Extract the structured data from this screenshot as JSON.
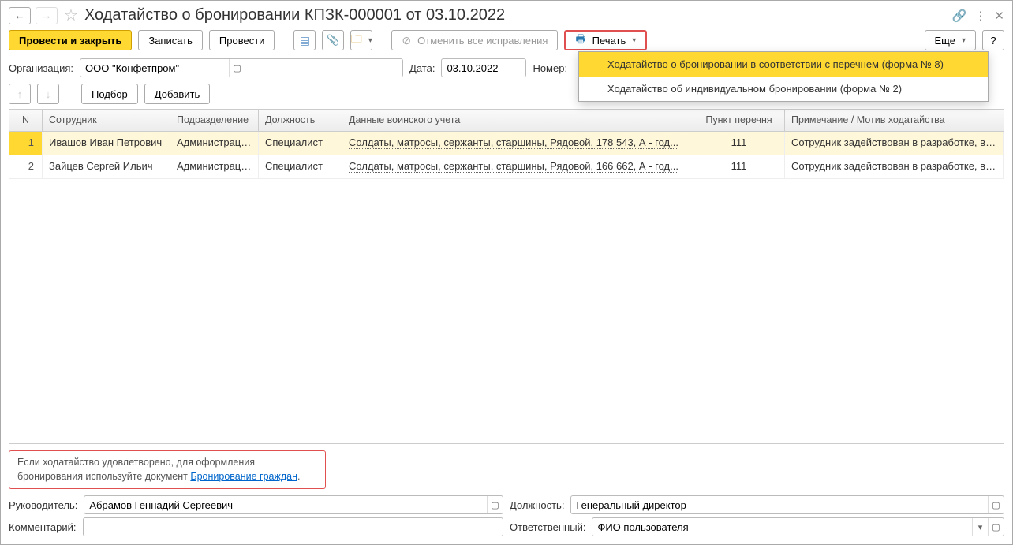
{
  "header": {
    "title": "Ходатайство о бронировании КПЗК-000001 от 03.10.2022"
  },
  "toolbar": {
    "post_close": "Провести и закрыть",
    "save": "Записать",
    "post": "Провести",
    "cancel_fixes": "Отменить все исправления",
    "print": "Печать",
    "more": "Еще",
    "help": "?"
  },
  "print_menu": {
    "item1": "Ходатайство о бронировании в соответствии с перечнем (форма № 8)",
    "item2": "Ходатайство об индивидуальном бронировании (форма № 2)"
  },
  "form": {
    "org_label": "Организация:",
    "org_value": "ООО \"Конфетпром\"",
    "date_label": "Дата:",
    "date_value": "03.10.2022",
    "number_label": "Номер:"
  },
  "sub_toolbar": {
    "select": "Подбор",
    "add": "Добавить"
  },
  "table": {
    "headers": {
      "n": "N",
      "emp": "Сотрудник",
      "dep": "Подразделение",
      "pos": "Должность",
      "mil": "Данные воинского учета",
      "point": "Пункт перечня",
      "note": "Примечание / Мотив ходатайства"
    },
    "rows": [
      {
        "n": "1",
        "emp": "Ивашов Иван Петрович",
        "dep": "Администрация",
        "pos": "Специалист",
        "mil": "Солдаты, матросы, сержанты, старшины, Рядовой, 178 543, А - год...",
        "point": "111",
        "note": "Сотрудник задействован в разработке, в с..."
      },
      {
        "n": "2",
        "emp": "Зайцев Сергей Ильич",
        "dep": "Администрация",
        "pos": "Специалист",
        "mil": "Солдаты, матросы, сержанты, старшины, Рядовой, 166 662, А - год...",
        "point": "111",
        "note": "Сотрудник задействован в разработке, в с..."
      }
    ]
  },
  "info": {
    "text1": "Если ходатайство удовлетворено, для оформления бронирования используйте документ ",
    "link": "Бронирование граждан",
    "text2": "."
  },
  "footer": {
    "manager_label": "Руководитель:",
    "manager_value": "Абрамов Геннадий Сергеевич",
    "position_label": "Должность:",
    "position_value": "Генеральный директор",
    "comment_label": "Комментарий:",
    "comment_value": "",
    "responsible_label": "Ответственный:",
    "responsible_value": "ФИО пользователя"
  }
}
